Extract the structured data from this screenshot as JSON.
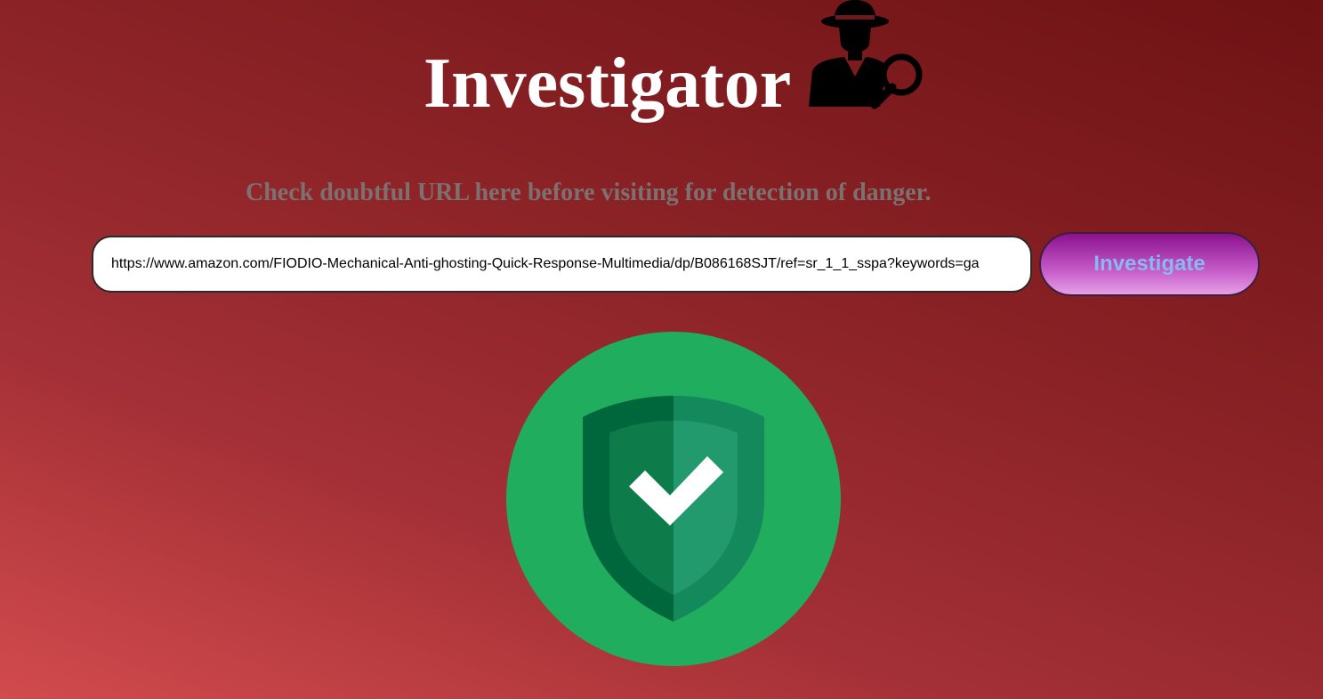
{
  "header": {
    "title": "Investigator",
    "logo_icon": "detective-magnifier-icon"
  },
  "main": {
    "subtitle": "Check doubtful URL here before visiting for detection of danger.",
    "url_input": {
      "value": "https://www.amazon.com/FIODIO-Mechanical-Anti-ghosting-Quick-Response-Multimedia/dp/B086168SJT/ref=sr_1_1_sspa?keywords=ga"
    },
    "investigate_button_label": "Investigate",
    "result": {
      "status_icon": "safe-shield-check-icon"
    }
  },
  "colors": {
    "background_top": "#6e1214",
    "background_bottom": "#d24b4d",
    "title": "#ffffff",
    "subtitle": "#7d7170",
    "button_top": "#8a128d",
    "button_bottom": "#e6a0e6",
    "button_text": "#8ab8f0",
    "shield_circle": "#20ad5e"
  }
}
